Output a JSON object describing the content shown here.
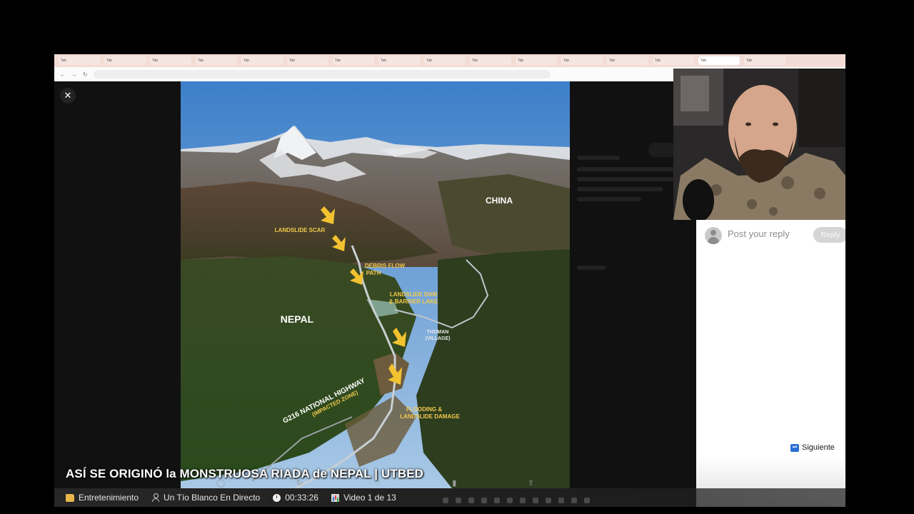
{
  "browser": {
    "tabs": [
      "Tab",
      "Tab",
      "Tab",
      "Tab",
      "Tab",
      "Tab",
      "Tab",
      "Tab",
      "Tab",
      "Tab",
      "Tab",
      "Tab",
      "Tab",
      "Tab",
      "Tab",
      "Tab"
    ]
  },
  "modal": {
    "close_glyph": "✕"
  },
  "photo": {
    "labels": {
      "china": "CHINA",
      "nepal": "NEPAL",
      "landslide_scar": "LANDSLIDE SCAR",
      "debris_1": "DEBRIS FLOW",
      "debris_2": "PATH",
      "dam_1": "LANDSLIDE DAM",
      "dam_2": "& BARRIER LAKE",
      "village_1": "THOMAN",
      "village_2": "(VILLAGE)",
      "highway_1": "G216 NATIONAL HIGHWAY",
      "highway_2": "(IMPACTED ZONE)",
      "flood_1": "FLOODING &",
      "flood_2": "LANDSLIDE DAMAGE"
    },
    "arrow_color": "#f2c230",
    "label_color": "#f2c94c"
  },
  "reply": {
    "placeholder": "Post your reply",
    "button": "Reply"
  },
  "next": {
    "label": "Siguiente"
  },
  "overlay": {
    "title": "ASÍ SE ORIGINÓ la MONSTRUOSA RIADA de NEPAL | UTBED"
  },
  "infobar": {
    "category": "Entretenimiento",
    "channel": "Un Tío Blanco En Directo",
    "time": "00:33:26",
    "video_count": "Video 1 de 13"
  }
}
